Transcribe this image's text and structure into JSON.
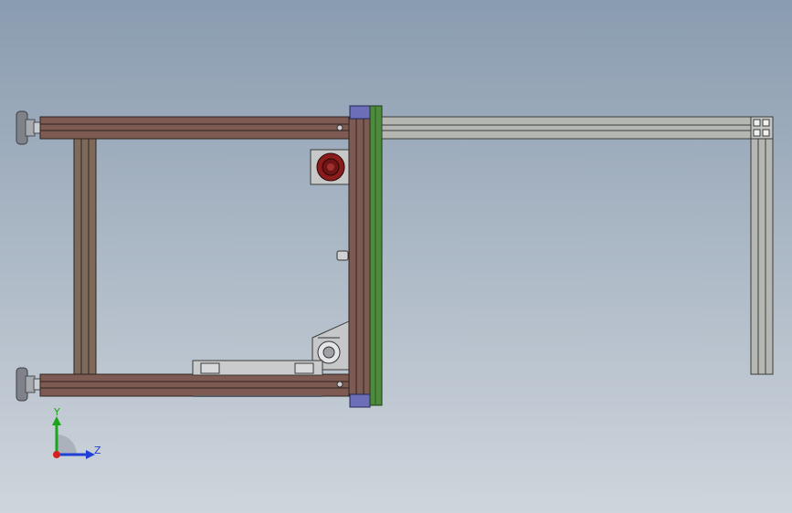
{
  "viewport": {
    "background_top": "#8a9cb0",
    "background_bottom": "#cfd5dc"
  },
  "triad": {
    "y_label": "Y",
    "z_label": "Z",
    "y_color": "#1aa51a",
    "z_color": "#1f3fd6",
    "x_color": "#d42020"
  },
  "colors": {
    "brown_profile": "#7d5a52",
    "green_plate": "#4d8a3c",
    "blue_block": "#6c6fb8",
    "grey_profile": "#b4b7b2",
    "motor_red": "#8b1c1c",
    "foot_grey": "#7f8389"
  }
}
